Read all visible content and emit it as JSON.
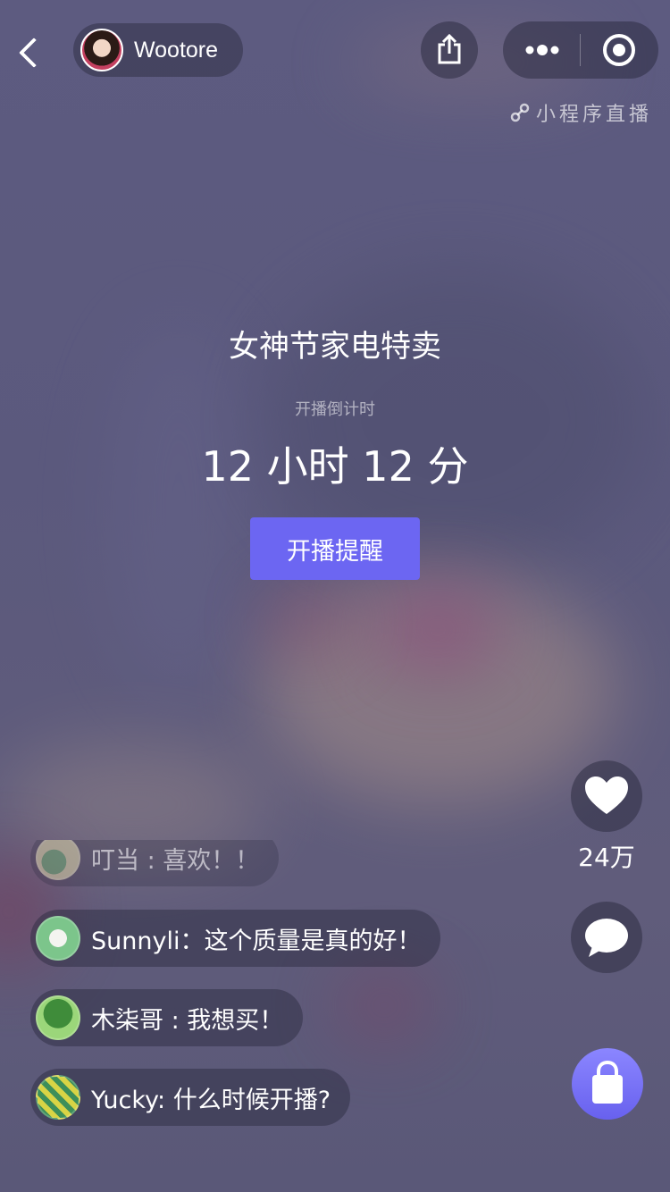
{
  "header": {
    "anchor_name": "Wootore",
    "mini_program_tag": "小程序直播"
  },
  "live": {
    "title": "女神节家电特卖",
    "countdown_label": "开播倒计时",
    "countdown_value": "12 小时 12 分",
    "remind_button": "开播提醒"
  },
  "actions": {
    "like_count": "24万"
  },
  "comments": [
    {
      "text": "叮当 : 喜欢！！"
    },
    {
      "text": "Sunnyli：这个质量是真的好！"
    },
    {
      "text": "木柒哥 : 我想买！"
    },
    {
      "text": "Yucky: 什么时候开播?"
    }
  ],
  "colors": {
    "accent": "#6c66f2",
    "background": "#5b597d"
  },
  "icons": [
    "back-icon",
    "share-icon",
    "more-icon",
    "close-target-icon",
    "link-icon",
    "heart-icon",
    "comment-icon",
    "shopping-bag-icon"
  ]
}
